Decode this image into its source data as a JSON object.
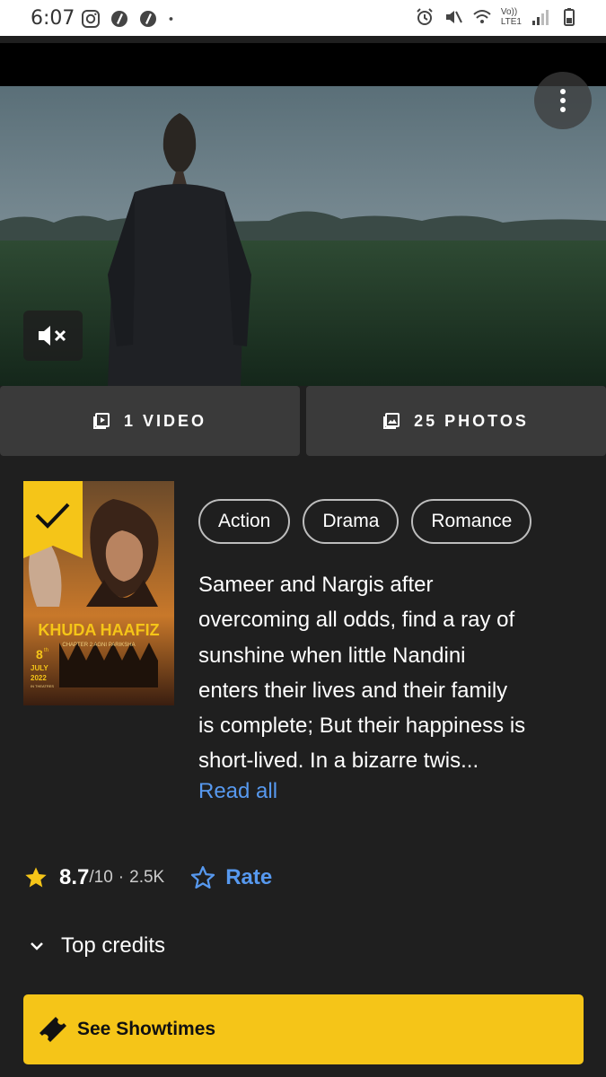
{
  "status_bar": {
    "time": "6:07",
    "left_icons": [
      "instagram-icon",
      "app-icon",
      "app-icon",
      "dot-icon"
    ],
    "right_icons": [
      "alarm-icon",
      "mute-icon",
      "wifi-icon",
      "volte-icon",
      "signal-icon",
      "battery-icon"
    ],
    "network_label_top": "Vo))",
    "network_label_bottom": "LTE1"
  },
  "video": {
    "more_icon": "more-vertical-icon",
    "mute_icon": "volume-off-icon"
  },
  "media": {
    "video_label": "1 VIDEO",
    "photos_label": "25 PHOTOS"
  },
  "poster": {
    "title": "KHUDA HAAFIZ",
    "subtitle": "CHAPTER 2 AGNI PARIKSHA",
    "release_day": "8",
    "release_suffix": "th",
    "release_month": "JULY",
    "release_year": "2022",
    "release_note": "IN THEATRES",
    "watchlist_icon": "checkmark-icon"
  },
  "genres": [
    "Action",
    "Drama",
    "Romance"
  ],
  "plot": {
    "lines": [
      "Sameer and Nargis after",
      "overcoming all odds, find a ray of",
      "sunshine when little Nandini",
      "enters their lives and their family",
      "is complete; But their happiness is",
      "short-lived. In a bizarre twis..."
    ],
    "read_all": "Read all"
  },
  "rating": {
    "value": "8.7",
    "out_of": "/10",
    "separator": "·",
    "count": "2.5K",
    "rate_label": "Rate"
  },
  "credits": {
    "label": "Top credits"
  },
  "showtimes": {
    "label": "See Showtimes"
  },
  "colors": {
    "accent_yellow": "#f5c518",
    "link_blue": "#5799ef",
    "background": "#1f1f1f"
  }
}
